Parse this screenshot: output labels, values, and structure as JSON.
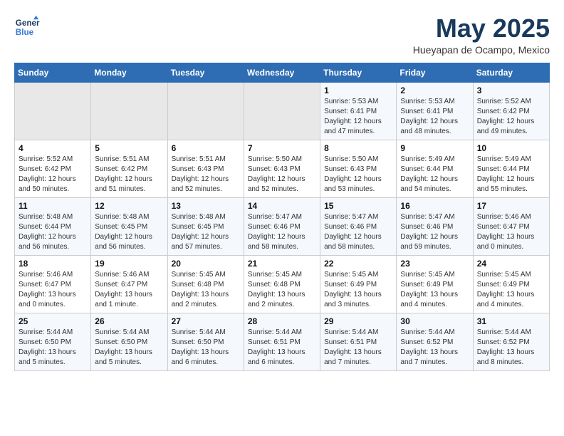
{
  "header": {
    "logo_line1": "General",
    "logo_line2": "Blue",
    "month": "May 2025",
    "location": "Hueyapan de Ocampo, Mexico"
  },
  "weekdays": [
    "Sunday",
    "Monday",
    "Tuesday",
    "Wednesday",
    "Thursday",
    "Friday",
    "Saturday"
  ],
  "weeks": [
    [
      {
        "day": "",
        "info": ""
      },
      {
        "day": "",
        "info": ""
      },
      {
        "day": "",
        "info": ""
      },
      {
        "day": "",
        "info": ""
      },
      {
        "day": "1",
        "info": "Sunrise: 5:53 AM\nSunset: 6:41 PM\nDaylight: 12 hours\nand 47 minutes."
      },
      {
        "day": "2",
        "info": "Sunrise: 5:53 AM\nSunset: 6:41 PM\nDaylight: 12 hours\nand 48 minutes."
      },
      {
        "day": "3",
        "info": "Sunrise: 5:52 AM\nSunset: 6:42 PM\nDaylight: 12 hours\nand 49 minutes."
      }
    ],
    [
      {
        "day": "4",
        "info": "Sunrise: 5:52 AM\nSunset: 6:42 PM\nDaylight: 12 hours\nand 50 minutes."
      },
      {
        "day": "5",
        "info": "Sunrise: 5:51 AM\nSunset: 6:42 PM\nDaylight: 12 hours\nand 51 minutes."
      },
      {
        "day": "6",
        "info": "Sunrise: 5:51 AM\nSunset: 6:43 PM\nDaylight: 12 hours\nand 52 minutes."
      },
      {
        "day": "7",
        "info": "Sunrise: 5:50 AM\nSunset: 6:43 PM\nDaylight: 12 hours\nand 52 minutes."
      },
      {
        "day": "8",
        "info": "Sunrise: 5:50 AM\nSunset: 6:43 PM\nDaylight: 12 hours\nand 53 minutes."
      },
      {
        "day": "9",
        "info": "Sunrise: 5:49 AM\nSunset: 6:44 PM\nDaylight: 12 hours\nand 54 minutes."
      },
      {
        "day": "10",
        "info": "Sunrise: 5:49 AM\nSunset: 6:44 PM\nDaylight: 12 hours\nand 55 minutes."
      }
    ],
    [
      {
        "day": "11",
        "info": "Sunrise: 5:48 AM\nSunset: 6:44 PM\nDaylight: 12 hours\nand 56 minutes."
      },
      {
        "day": "12",
        "info": "Sunrise: 5:48 AM\nSunset: 6:45 PM\nDaylight: 12 hours\nand 56 minutes."
      },
      {
        "day": "13",
        "info": "Sunrise: 5:48 AM\nSunset: 6:45 PM\nDaylight: 12 hours\nand 57 minutes."
      },
      {
        "day": "14",
        "info": "Sunrise: 5:47 AM\nSunset: 6:46 PM\nDaylight: 12 hours\nand 58 minutes."
      },
      {
        "day": "15",
        "info": "Sunrise: 5:47 AM\nSunset: 6:46 PM\nDaylight: 12 hours\nand 58 minutes."
      },
      {
        "day": "16",
        "info": "Sunrise: 5:47 AM\nSunset: 6:46 PM\nDaylight: 12 hours\nand 59 minutes."
      },
      {
        "day": "17",
        "info": "Sunrise: 5:46 AM\nSunset: 6:47 PM\nDaylight: 13 hours\nand 0 minutes."
      }
    ],
    [
      {
        "day": "18",
        "info": "Sunrise: 5:46 AM\nSunset: 6:47 PM\nDaylight: 13 hours\nand 0 minutes."
      },
      {
        "day": "19",
        "info": "Sunrise: 5:46 AM\nSunset: 6:47 PM\nDaylight: 13 hours\nand 1 minute."
      },
      {
        "day": "20",
        "info": "Sunrise: 5:45 AM\nSunset: 6:48 PM\nDaylight: 13 hours\nand 2 minutes."
      },
      {
        "day": "21",
        "info": "Sunrise: 5:45 AM\nSunset: 6:48 PM\nDaylight: 13 hours\nand 2 minutes."
      },
      {
        "day": "22",
        "info": "Sunrise: 5:45 AM\nSunset: 6:49 PM\nDaylight: 13 hours\nand 3 minutes."
      },
      {
        "day": "23",
        "info": "Sunrise: 5:45 AM\nSunset: 6:49 PM\nDaylight: 13 hours\nand 4 minutes."
      },
      {
        "day": "24",
        "info": "Sunrise: 5:45 AM\nSunset: 6:49 PM\nDaylight: 13 hours\nand 4 minutes."
      }
    ],
    [
      {
        "day": "25",
        "info": "Sunrise: 5:44 AM\nSunset: 6:50 PM\nDaylight: 13 hours\nand 5 minutes."
      },
      {
        "day": "26",
        "info": "Sunrise: 5:44 AM\nSunset: 6:50 PM\nDaylight: 13 hours\nand 5 minutes."
      },
      {
        "day": "27",
        "info": "Sunrise: 5:44 AM\nSunset: 6:50 PM\nDaylight: 13 hours\nand 6 minutes."
      },
      {
        "day": "28",
        "info": "Sunrise: 5:44 AM\nSunset: 6:51 PM\nDaylight: 13 hours\nand 6 minutes."
      },
      {
        "day": "29",
        "info": "Sunrise: 5:44 AM\nSunset: 6:51 PM\nDaylight: 13 hours\nand 7 minutes."
      },
      {
        "day": "30",
        "info": "Sunrise: 5:44 AM\nSunset: 6:52 PM\nDaylight: 13 hours\nand 7 minutes."
      },
      {
        "day": "31",
        "info": "Sunrise: 5:44 AM\nSunset: 6:52 PM\nDaylight: 13 hours\nand 8 minutes."
      }
    ]
  ]
}
